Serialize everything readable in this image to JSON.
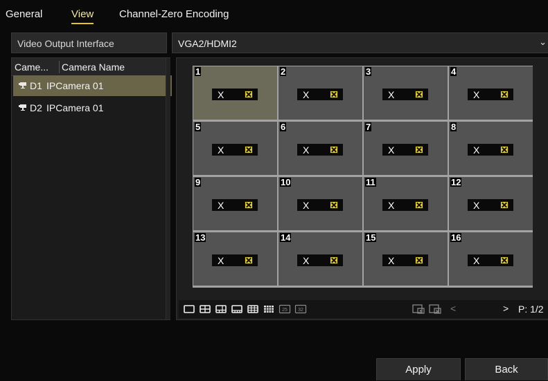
{
  "tabs": [
    {
      "label": "General"
    },
    {
      "label": "View"
    },
    {
      "label": "Channel-Zero Encoding"
    }
  ],
  "output": {
    "label": "Video Output Interface",
    "value": "VGA2/HDMI2"
  },
  "camera_table": {
    "columns": [
      "Came...",
      "Camera Name"
    ],
    "rows": [
      {
        "id": "D1",
        "name": "IPCamera 01"
      },
      {
        "id": "D2",
        "name": "IPCamera 01"
      }
    ]
  },
  "grid": {
    "cells": [
      {
        "num": "1",
        "label": "X"
      },
      {
        "num": "2",
        "label": "X"
      },
      {
        "num": "3",
        "label": "X"
      },
      {
        "num": "4",
        "label": "X"
      },
      {
        "num": "5",
        "label": "X"
      },
      {
        "num": "6",
        "label": "X"
      },
      {
        "num": "7",
        "label": "X"
      },
      {
        "num": "8",
        "label": "X"
      },
      {
        "num": "9",
        "label": "X"
      },
      {
        "num": "10",
        "label": "X"
      },
      {
        "num": "11",
        "label": "X"
      },
      {
        "num": "12",
        "label": "X"
      },
      {
        "num": "13",
        "label": "X"
      },
      {
        "num": "14",
        "label": "X"
      },
      {
        "num": "15",
        "label": "X"
      },
      {
        "num": "16",
        "label": "X"
      }
    ]
  },
  "toolbar": {
    "layout_icons": [
      "layout-1x1-icon",
      "layout-2x2-icon",
      "layout-1plus5-icon",
      "layout-1plus7-icon",
      "layout-3x3-icon",
      "layout-4x4-icon",
      "layout-25-icon",
      "layout-32-icon"
    ],
    "layout_25_label": "25",
    "layout_32_label": "32",
    "prev_glyph": "<",
    "next_glyph": ">",
    "page_label": "P: 1/2"
  },
  "buttons": {
    "apply": "Apply",
    "back": "Back"
  },
  "colors": {
    "accent": "#e8c61e",
    "selected_row": "#6a6548",
    "cell_bg": "#535353",
    "grid_lines": "#a3a3a3"
  }
}
